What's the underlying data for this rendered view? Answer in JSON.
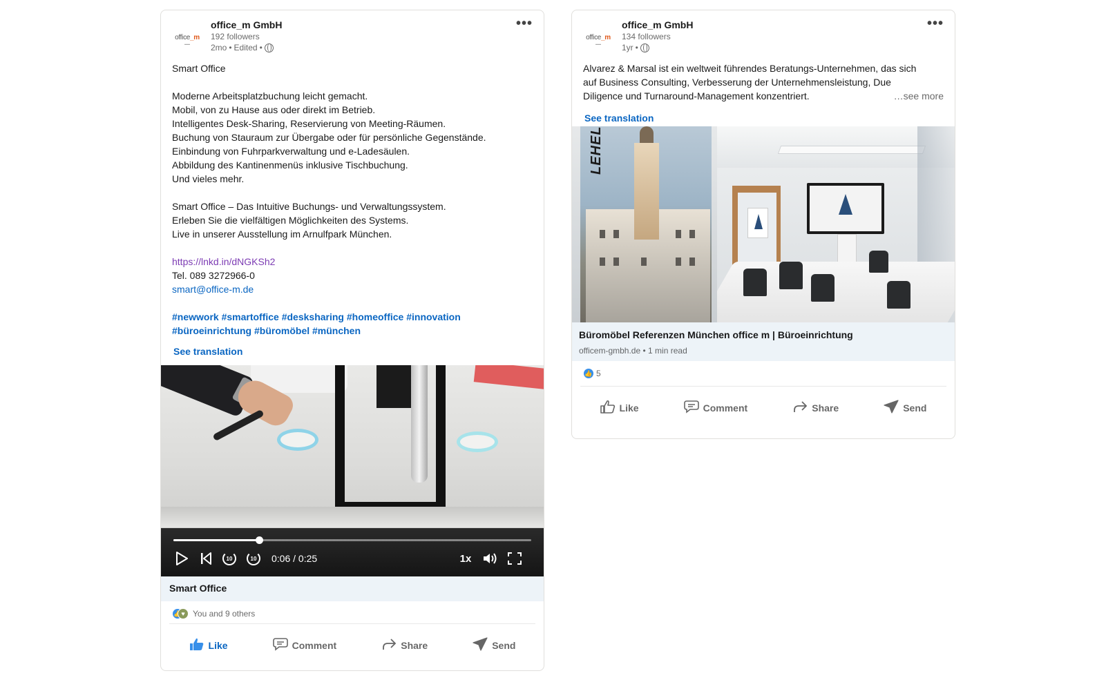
{
  "colors": {
    "link": "#0a66c2",
    "visited_link": "#7c3bb3",
    "bar_bg": "#edf3f8",
    "liked": "#0a66c2"
  },
  "post1": {
    "company_logo_text": "office",
    "company_logo_mark": "_m",
    "author": "office_m GmbH",
    "followers": "192 followers",
    "time": "2mo",
    "edited": "Edited",
    "paragraph1": "Smart Office",
    "paragraph2": "Moderne Arbeitsplatzbuchung leicht gemacht.\nMobil, von zu Hause aus oder direkt im Betrieb.\nIntelligentes Desk-Sharing, Reservierung von Meeting-Räumen.\nBuchung von Stauraum zur Übergabe oder für persönliche Gegenstände.\nEinbindung von Fuhrparkverwaltung und e-Ladesäulen.\nAbbildung des Kantinenmenüs inklusive Tischbuchung.\nUnd vieles mehr.",
    "paragraph3": "Smart Office – Das Intuitive Buchungs- und Verwaltungssystem.\nErleben Sie die vielfältigen Möglichkeiten des Systems.\nLive in unserer Ausstellung im Arnulfpark München.",
    "short_link": "https://lnkd.in/dNGKSh2",
    "phone": "Tel. 089 3272966-0",
    "email": "smart@office-m.de",
    "hashtags_line1": "#newwork #smartoffice #desksharing #homeoffice #innovation",
    "hashtags_line2": "#büroeinrichtung #büromöbel #münchen",
    "see_translation": "See translation",
    "video": {
      "current_time": "0:06",
      "duration": "0:25",
      "time_display": "0:06 / 0:25",
      "progress_fraction": 0.24,
      "rate": "1x",
      "rewind_label": "10",
      "forward_label": "10"
    },
    "video_title": "Smart Office",
    "reactions_text": "You and 9 others",
    "actions": {
      "like": "Like",
      "comment": "Comment",
      "share": "Share",
      "send": "Send"
    }
  },
  "post2": {
    "company_logo_text": "office",
    "company_logo_mark": "_m",
    "author": "office_m GmbH",
    "followers": "134 followers",
    "time": "1yr",
    "body_line1": "Alvarez & Marsal ist ein weltweit führendes Beratungs-Unternehmen, das sich",
    "body_line2": "auf Business Consulting, Verbesserung der Unternehmensleistung, Due",
    "body_line3": "Diligence und Turnaround-Management konzentriert.",
    "see_more": "…see more",
    "see_translation": "See translation",
    "image_text": "LEHEL",
    "article_title": "Büromöbel Referenzen München office m | Büroeinrichtung",
    "article_source": "officem-gmbh.de",
    "article_read": "1 min read",
    "reactions_count": "5",
    "actions": {
      "like": "Like",
      "comment": "Comment",
      "share": "Share",
      "send": "Send"
    }
  }
}
